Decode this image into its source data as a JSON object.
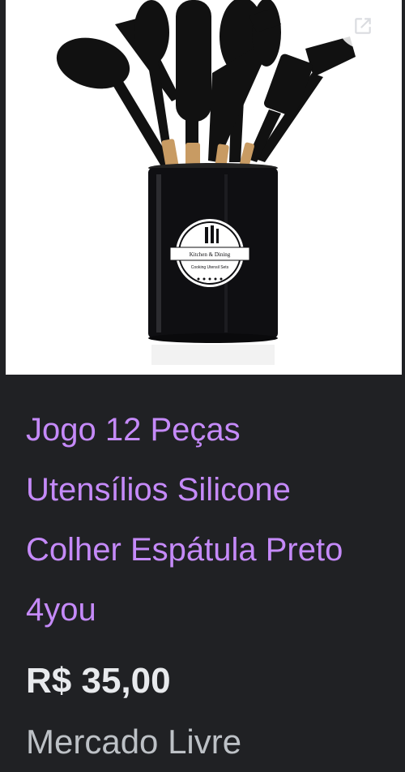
{
  "product": {
    "title": "Jogo 12 Peças Utensílios Silicone Colher Espátula Preto 4you",
    "price": "R$ 35,00",
    "store": "Mercado Livre",
    "image_label_line1": "Kitchen & Dining",
    "image_label_line2": "Cooking Utensil Sets"
  },
  "colors": {
    "background": "#202124",
    "title": "#c58af9",
    "price": "#e8eaed",
    "store": "#bdc1c6",
    "image_bg": "#ffffff"
  },
  "icons": {
    "open_link": "open-in-new-icon"
  }
}
